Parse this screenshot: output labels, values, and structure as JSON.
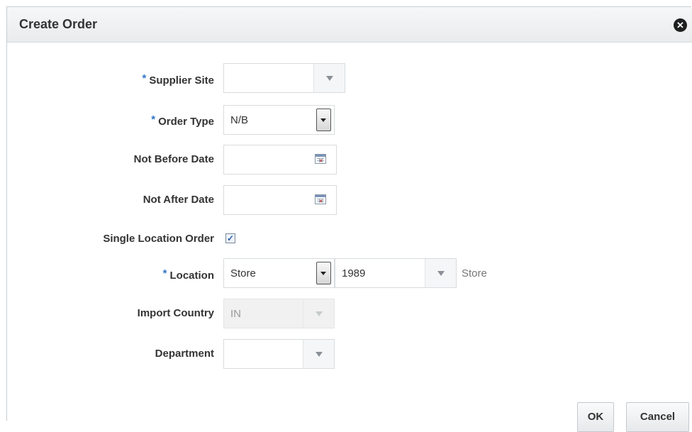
{
  "dialog": {
    "title": "Create Order",
    "close_icon": "close-circle-icon",
    "close_glyph": "✕"
  },
  "form": {
    "required_marker": "*",
    "supplier_site": {
      "label": "Supplier Site",
      "value": ""
    },
    "order_type": {
      "label": "Order Type",
      "value": "N/B"
    },
    "not_before_date": {
      "label": "Not Before Date",
      "value": ""
    },
    "not_after_date": {
      "label": "Not After Date",
      "value": ""
    },
    "single_location_order": {
      "label": "Single Location Order",
      "checked": true,
      "check_glyph": "✓"
    },
    "location": {
      "label": "Location",
      "type_value": "Store",
      "id_value": "1989",
      "description": "Store"
    },
    "import_country": {
      "label": "Import Country",
      "value": "IN"
    },
    "department": {
      "label": "Department",
      "value": ""
    }
  },
  "buttons": {
    "ok": "OK",
    "cancel": "Cancel"
  }
}
